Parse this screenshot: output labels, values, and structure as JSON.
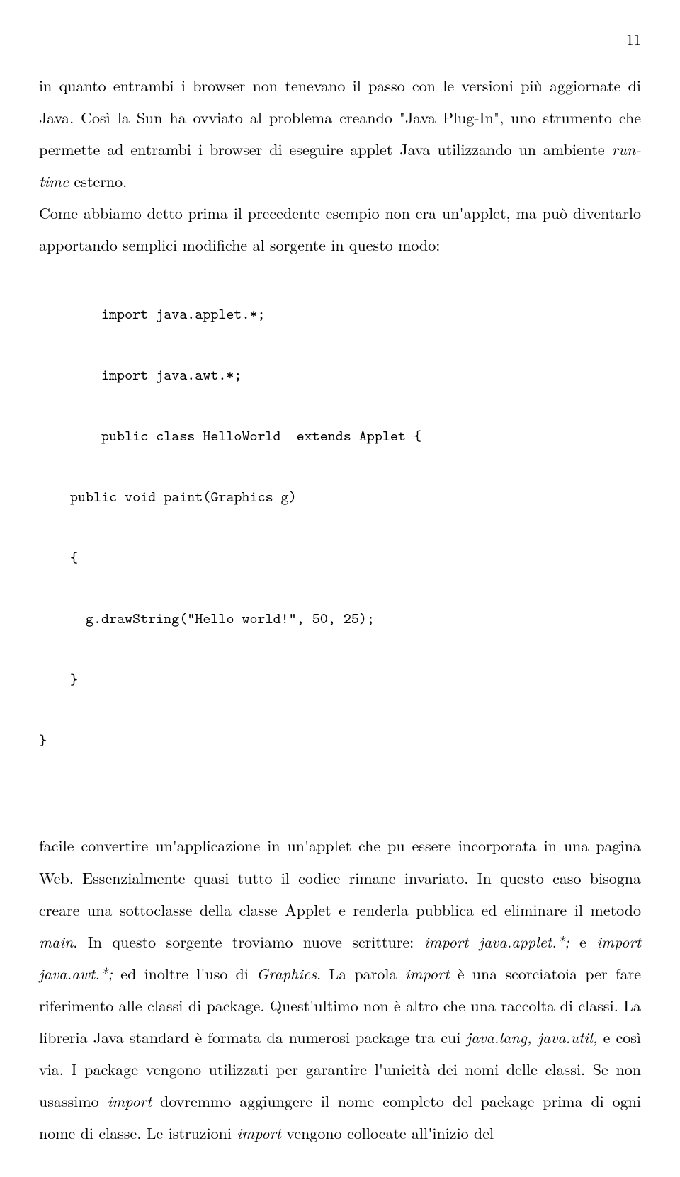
{
  "page_number": "11",
  "para1_a": "in quanto entrambi i browser non tenevano il passo con le versioni più aggiornate di Java. Così la Sun ha ovviato al problema creando \"Java Plug-In\", uno strumento che permette ad entrambi i browser di eseguire applet Java utilizzando un ambiente ",
  "para1_b": "run-time",
  "para1_c": " esterno.",
  "para2": "Come abbiamo detto prima il precedente esempio non era un'applet, ma può diventarlo apportando semplici modifiche al sorgente in questo modo:",
  "code": {
    "l1": "import java.applet.*;",
    "l2": "import java.awt.*;",
    "l3": "public class HelloWorld  extends Applet {",
    "l4": "public void paint(Graphics g)",
    "l5": "{",
    "l6": "g.drawString(\"Hello world!\", 50, 25);",
    "l7": "}",
    "l8": "}"
  },
  "para3_a": " facile convertire un'applicazione in un'applet che pu essere incorporata in una pagina Web. Essenzialmente quasi tutto il codice rimane invariato. In questo caso bisogna creare una sottoclasse della classe Applet e renderla pubblica ed eliminare il metodo ",
  "para3_b": "main",
  "para3_c": ". In questo sorgente troviamo nuove scritture: ",
  "para3_d": "import java.applet.*;",
  "para3_e": " e ",
  "para3_f": "import java.awt.*;",
  "para3_g": " ed inoltre l'uso di ",
  "para3_h": "Graphics",
  "para3_i": ". La parola ",
  "para3_j": "import",
  "para3_k": " è una scorciatoia per fare riferimento alle classi di package. Quest'ultimo non è altro che una raccolta di classi. La libreria Java standard è formata da numerosi package tra cui ",
  "para3_l": "java.lang, java.util,",
  "para3_m": " e così via. I package vengono utilizzati per garantire l'unicità dei nomi delle classi. Se non usassimo ",
  "para3_n": "import",
  "para3_o": " dovremmo aggiungere il nome completo del package prima di ogni nome di classe. Le istruzioni ",
  "para3_p": "import",
  "para3_q": " vengono collocate all'inizio del"
}
